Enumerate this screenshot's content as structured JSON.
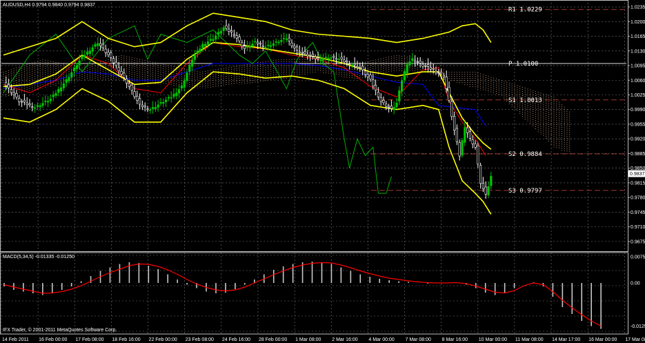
{
  "colors": {
    "background": "#000000",
    "grid": "#7a7a7a",
    "bull": "#00c400",
    "bear": "#ffffff",
    "bollinger": "#ffff00",
    "tenkan": "#ff0000",
    "kijun": "#0000ff",
    "chikou": "#00b000",
    "cloud": "#d2a98a",
    "pivot_line": "#9c3c2c",
    "macd_hist": "#c8c8c8",
    "macd_signal": "#ff0000",
    "text": "#ffffff"
  },
  "main_title": "AUDUSD,H4  0.9794 0.9840 0.9794 0.9837",
  "macd_title": "MACD(5,34,5) -0.01335 -0.01250",
  "footer": "IFX Trader, © 2001-2011 MetaQuotes Software Corp.",
  "current_price": "0.9837",
  "chart_data": [
    {
      "type": "candlestick",
      "title": "AUDUSD,H4  0.9794 0.9840 0.9794 0.9837",
      "ylim": [
        0.9655,
        1.0245
      ],
      "y_tick_labels": [
        "1.0235",
        "1.0200",
        "1.0165",
        "1.0130",
        "1.0095",
        "1.0060",
        "1.0025",
        "0.9990",
        "0.9955",
        "0.9920",
        "0.9885",
        "0.9850",
        "0.9815",
        "0.9780",
        "0.9745",
        "0.9710",
        "0.9675"
      ],
      "x_tick_labels": [
        "14 Feb 2011",
        "16 Feb 00:00",
        "17 Feb 08:00",
        "18 Feb 16:00",
        "22 Feb 00:00",
        "23 Feb 08:00",
        "24 Feb 16:00",
        "28 Feb 00:00",
        "1 Mar 08:00",
        "2 Mar 16:00",
        "4 Mar 00:00",
        "7 Mar 08:00",
        "8 Mar 16:00",
        "10 Mar 00:00",
        "11 Mar 08:00",
        "14 Mar 17:00",
        "16 Mar 00:00",
        "17 Mar 08:00"
      ],
      "pivot_levels": [
        {
          "label": "R1",
          "value": 1.0229,
          "text": "R1 1.0229"
        },
        {
          "label": "P",
          "value": 1.01,
          "text": "P 1.0100"
        },
        {
          "label": "S1",
          "value": 1.0013,
          "text": "S1 1.0013"
        },
        {
          "label": "S2",
          "value": 0.9884,
          "text": "S2 0.9884"
        },
        {
          "label": "S3",
          "value": 0.9797,
          "text": "S3 0.9797"
        }
      ],
      "last_close": 0.9837,
      "close_path": [
        [
          0,
          1.0055
        ],
        [
          6,
          1.001
        ],
        [
          12,
          0.9995
        ],
        [
          18,
          1.0015
        ],
        [
          24,
          1.006
        ],
        [
          30,
          1.0115
        ],
        [
          36,
          1.015
        ],
        [
          40,
          1.012
        ],
        [
          44,
          1.0085
        ],
        [
          48,
          1.0045
        ],
        [
          52,
          1.0
        ],
        [
          56,
          0.999
        ],
        [
          60,
          1.0005
        ],
        [
          64,
          1.002
        ],
        [
          68,
          1.0045
        ],
        [
          72,
          1.011
        ],
        [
          76,
          1.0145
        ],
        [
          80,
          1.016
        ],
        [
          84,
          1.0185
        ],
        [
          88,
          1.017
        ],
        [
          92,
          1.0135
        ],
        [
          96,
          1.015
        ],
        [
          100,
          1.014
        ],
        [
          104,
          1.015
        ],
        [
          108,
          1.016
        ],
        [
          112,
          1.013
        ],
        [
          116,
          1.012
        ],
        [
          120,
          1.011
        ],
        [
          124,
          1.0115
        ],
        [
          128,
          1.011
        ],
        [
          132,
          1.01
        ],
        [
          136,
          1.009
        ],
        [
          140,
          1.006
        ],
        [
          144,
          1.001
        ],
        [
          148,
          0.999
        ],
        [
          150,
          1.0005
        ],
        [
          152,
          1.006
        ],
        [
          154,
          1.01
        ],
        [
          156,
          1.011
        ],
        [
          160,
          1.0095
        ],
        [
          164,
          1.0085
        ],
        [
          168,
          1.007
        ],
        [
          170,
          1.001
        ],
        [
          172,
          0.994
        ],
        [
          174,
          0.988
        ],
        [
          176,
          0.995
        ],
        [
          178,
          0.992
        ],
        [
          180,
          0.99
        ],
        [
          182,
          0.9815
        ],
        [
          184,
          0.9785
        ],
        [
          186,
          0.983
        ]
      ],
      "bollinger_upper_path": [
        [
          0,
          1.012
        ],
        [
          10,
          1.014
        ],
        [
          20,
          1.016
        ],
        [
          30,
          1.02
        ],
        [
          40,
          1.016
        ],
        [
          50,
          1.014
        ],
        [
          60,
          1.015
        ],
        [
          70,
          1.019
        ],
        [
          80,
          1.022
        ],
        [
          90,
          1.021
        ],
        [
          100,
          1.02
        ],
        [
          110,
          1.018
        ],
        [
          120,
          1.017
        ],
        [
          130,
          1.0165
        ],
        [
          140,
          1.016
        ],
        [
          150,
          1.015
        ],
        [
          160,
          1.016
        ],
        [
          170,
          1.0175
        ],
        [
          175,
          1.019
        ],
        [
          180,
          1.0195
        ],
        [
          183,
          1.018
        ],
        [
          186,
          1.015
        ]
      ],
      "bollinger_lower_path": [
        [
          0,
          0.997
        ],
        [
          10,
          0.996
        ],
        [
          20,
          0.999
        ],
        [
          30,
          1.004
        ],
        [
          40,
          1.001
        ],
        [
          50,
          0.996
        ],
        [
          60,
          0.996
        ],
        [
          70,
          1.003
        ],
        [
          80,
          1.008
        ],
        [
          90,
          1.0075
        ],
        [
          100,
          1.0065
        ],
        [
          110,
          1.007
        ],
        [
          120,
          1.006
        ],
        [
          130,
          1.004
        ],
        [
          140,
          1.0
        ],
        [
          150,
          0.999
        ],
        [
          160,
          1.0
        ],
        [
          166,
          0.999
        ],
        [
          170,
          0.99
        ],
        [
          175,
          0.982
        ],
        [
          180,
          0.979
        ],
        [
          183,
          0.977
        ],
        [
          186,
          0.974
        ]
      ],
      "bollinger_mid_path": [
        [
          0,
          1.0045
        ],
        [
          10,
          1.005
        ],
        [
          20,
          1.0075
        ],
        [
          30,
          1.012
        ],
        [
          40,
          1.0085
        ],
        [
          50,
          1.005
        ],
        [
          60,
          1.0055
        ],
        [
          70,
          1.011
        ],
        [
          80,
          1.015
        ],
        [
          90,
          1.0145
        ],
        [
          100,
          1.0135
        ],
        [
          110,
          1.0125
        ],
        [
          120,
          1.0115
        ],
        [
          130,
          1.01
        ],
        [
          140,
          1.008
        ],
        [
          150,
          1.007
        ],
        [
          160,
          1.008
        ],
        [
          166,
          1.008
        ],
        [
          170,
          1.003
        ],
        [
          175,
          0.997
        ],
        [
          180,
          0.993
        ],
        [
          183,
          0.991
        ],
        [
          186,
          0.9895
        ]
      ],
      "tenkan_path": [
        [
          0,
          1.005
        ],
        [
          10,
          1.003
        ],
        [
          20,
          1.006
        ],
        [
          30,
          1.012
        ],
        [
          40,
          1.01
        ],
        [
          50,
          1.004
        ],
        [
          60,
          1.003
        ],
        [
          70,
          1.01
        ],
        [
          80,
          1.015
        ],
        [
          90,
          1.014
        ],
        [
          100,
          1.0135
        ],
        [
          110,
          1.012
        ],
        [
          120,
          1.011
        ],
        [
          130,
          1.009
        ],
        [
          140,
          1.0045
        ],
        [
          150,
          1.002
        ],
        [
          160,
          1.0085
        ],
        [
          166,
          1.009
        ],
        [
          170,
          1.001
        ],
        [
          175,
          0.996
        ],
        [
          180,
          0.992
        ],
        [
          184,
          0.988
        ]
      ],
      "kijun_path": [
        [
          0,
          1.004
        ],
        [
          10,
          1.005
        ],
        [
          20,
          1.006
        ],
        [
          30,
          1.008
        ],
        [
          40,
          1.0075
        ],
        [
          50,
          1.006
        ],
        [
          60,
          1.006
        ],
        [
          70,
          1.008
        ],
        [
          80,
          1.01
        ],
        [
          90,
          1.01
        ],
        [
          100,
          1.01
        ],
        [
          110,
          1.01
        ],
        [
          120,
          1.0095
        ],
        [
          130,
          1.0085
        ],
        [
          140,
          1.007
        ],
        [
          150,
          1.0055
        ],
        [
          160,
          1.005
        ],
        [
          166,
          1.0
        ],
        [
          172,
          0.9995
        ],
        [
          180,
          0.999
        ],
        [
          184,
          0.995
        ]
      ],
      "chikou_path": [
        [
          0,
          1.003
        ],
        [
          10,
          1.012
        ],
        [
          20,
          1.017
        ],
        [
          30,
          1.008
        ],
        [
          40,
          1.016
        ],
        [
          50,
          1.019
        ],
        [
          55,
          1.011
        ],
        [
          60,
          1.017
        ],
        [
          70,
          1.015
        ],
        [
          80,
          1.018
        ],
        [
          90,
          1.012
        ],
        [
          95,
          1.01
        ],
        [
          100,
          1.013
        ],
        [
          108,
          1.004
        ],
        [
          112,
          1.011
        ],
        [
          118,
          1.015
        ],
        [
          122,
          1.01
        ],
        [
          126,
          1.008
        ],
        [
          130,
          0.992
        ],
        [
          132,
          0.985
        ],
        [
          135,
          0.992
        ],
        [
          138,
          0.988
        ],
        [
          141,
          0.99
        ],
        [
          143,
          0.979
        ],
        [
          146,
          0.979
        ],
        [
          148,
          0.983
        ]
      ],
      "cloud_path": [
        [
          0,
          1.008,
          1.002
        ],
        [
          15,
          1.011,
          1.004
        ],
        [
          30,
          1.009,
          1.006
        ],
        [
          45,
          1.012,
          1.006
        ],
        [
          60,
          1.01,
          1.005
        ],
        [
          75,
          1.008,
          1.004
        ],
        [
          90,
          1.0095,
          1.005
        ],
        [
          105,
          1.011,
          1.006
        ],
        [
          120,
          1.011,
          1.008
        ],
        [
          135,
          1.01,
          1.006
        ],
        [
          150,
          1.012,
          1.008
        ],
        [
          160,
          1.011,
          1.008
        ],
        [
          170,
          1.008,
          1.006
        ],
        [
          180,
          1.008,
          1.004
        ],
        [
          190,
          1.006,
          1.002
        ],
        [
          200,
          1.004,
          0.996
        ],
        [
          210,
          1.002,
          0.99
        ],
        [
          216,
          0.9985,
          0.9885
        ]
      ]
    },
    {
      "type": "bar",
      "title": "MACD(5,34,5) -0.01335 -0.01250",
      "ylim": [
        -0.014,
        0.008
      ],
      "y_tick_labels": [
        "0.00756",
        "0.00",
        "-0.01250"
      ],
      "series": [
        {
          "name": "MACD",
          "values": [
            -0.001,
            -0.002,
            -0.0025,
            -0.003,
            -0.0035,
            -0.0028,
            -0.002,
            -0.001,
            0.0005,
            0.002,
            0.0035,
            0.0045,
            0.0055,
            0.006,
            0.0058,
            0.005,
            0.004,
            0.0025,
            0.001,
            -0.0005,
            -0.0015,
            -0.0025,
            -0.003,
            -0.0028,
            -0.0018,
            -0.0005,
            0.001,
            0.0025,
            0.0038,
            0.0048,
            0.0055,
            0.006,
            0.0062,
            0.006,
            0.0055,
            0.0045,
            0.0035,
            0.0025,
            0.0018,
            0.0012,
            0.0008,
            0.0005,
            0.0003,
            0.0,
            -0.0002,
            -0.0001,
            0.0,
            0.0001,
            -0.0005,
            -0.0015,
            -0.0028,
            -0.0035,
            -0.003,
            -0.0015,
            0.0,
            0.0002,
            -0.001,
            -0.004,
            -0.007,
            -0.009,
            -0.011,
            -0.0125,
            -0.0133
          ]
        },
        {
          "name": "Signal",
          "values": [
            -0.0005,
            -0.0012,
            -0.0018,
            -0.0024,
            -0.003,
            -0.0029,
            -0.0025,
            -0.0018,
            -0.0008,
            0.0005,
            0.0018,
            0.003,
            0.004,
            0.005,
            0.0055,
            0.0054,
            0.0048,
            0.0038,
            0.0025,
            0.001,
            -0.0003,
            -0.0013,
            -0.002,
            -0.0023,
            -0.002,
            -0.0012,
            0.0,
            0.0012,
            0.0024,
            0.0035,
            0.0045,
            0.0052,
            0.0057,
            0.0059,
            0.0058,
            0.0052,
            0.0044,
            0.0035,
            0.0027,
            0.002,
            0.0014,
            0.001,
            0.0006,
            0.0003,
            0.0001,
            0.0,
            0.0,
            0.0001,
            -0.0002,
            -0.0009,
            -0.0018,
            -0.0027,
            -0.0029,
            -0.0022,
            -0.0008,
            0.0,
            -0.0005,
            -0.0025,
            -0.005,
            -0.0072,
            -0.0092,
            -0.011,
            -0.0125
          ]
        }
      ]
    }
  ]
}
